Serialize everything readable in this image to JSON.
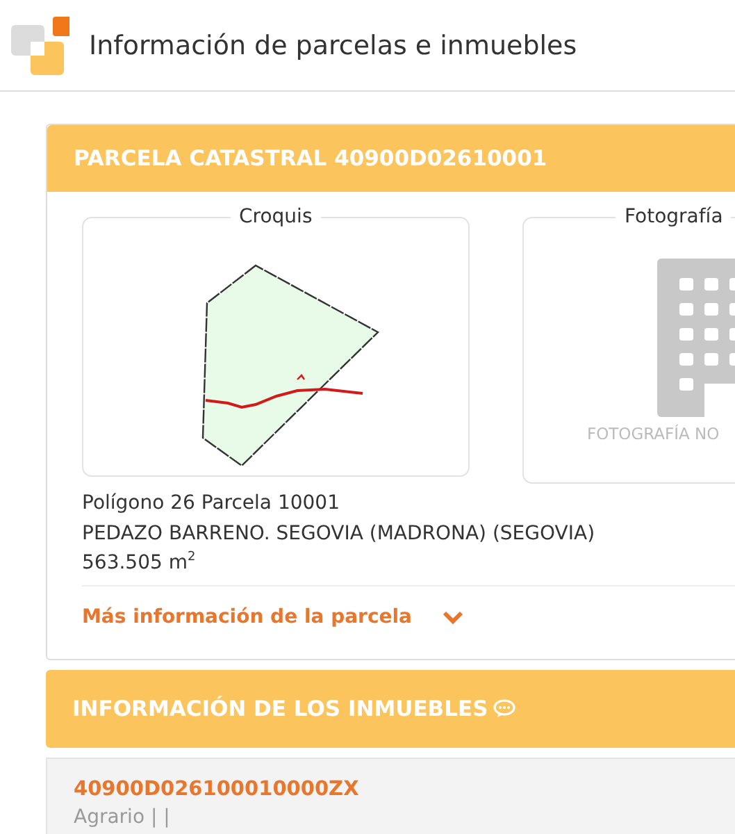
{
  "header": {
    "title": "Información de parcelas e inmuebles"
  },
  "parcel": {
    "title": "PARCELA CATASTRAL 40900D02610001",
    "sketch": {
      "label": "Croquis"
    },
    "photo": {
      "label": "Fotografía",
      "caption": "FOTOGRAFÍA NO"
    },
    "lines": [
      "Polígono 26 Parcela 10001",
      "PEDAZO BARRENO. SEGOVIA (MADRONA) (SEGOVIA)",
      "563.505 m$^{2}$"
    ],
    "more_link": {
      "label": "Más información de la parcela",
      "expanded": false
    }
  },
  "properties": {
    "title": "INFORMACIÓN DE LOS INMUEBLES",
    "items": [
      {
        "reference": "40900D026100010000ZX",
        "use": "Agrario | |"
      }
    ]
  }
}
